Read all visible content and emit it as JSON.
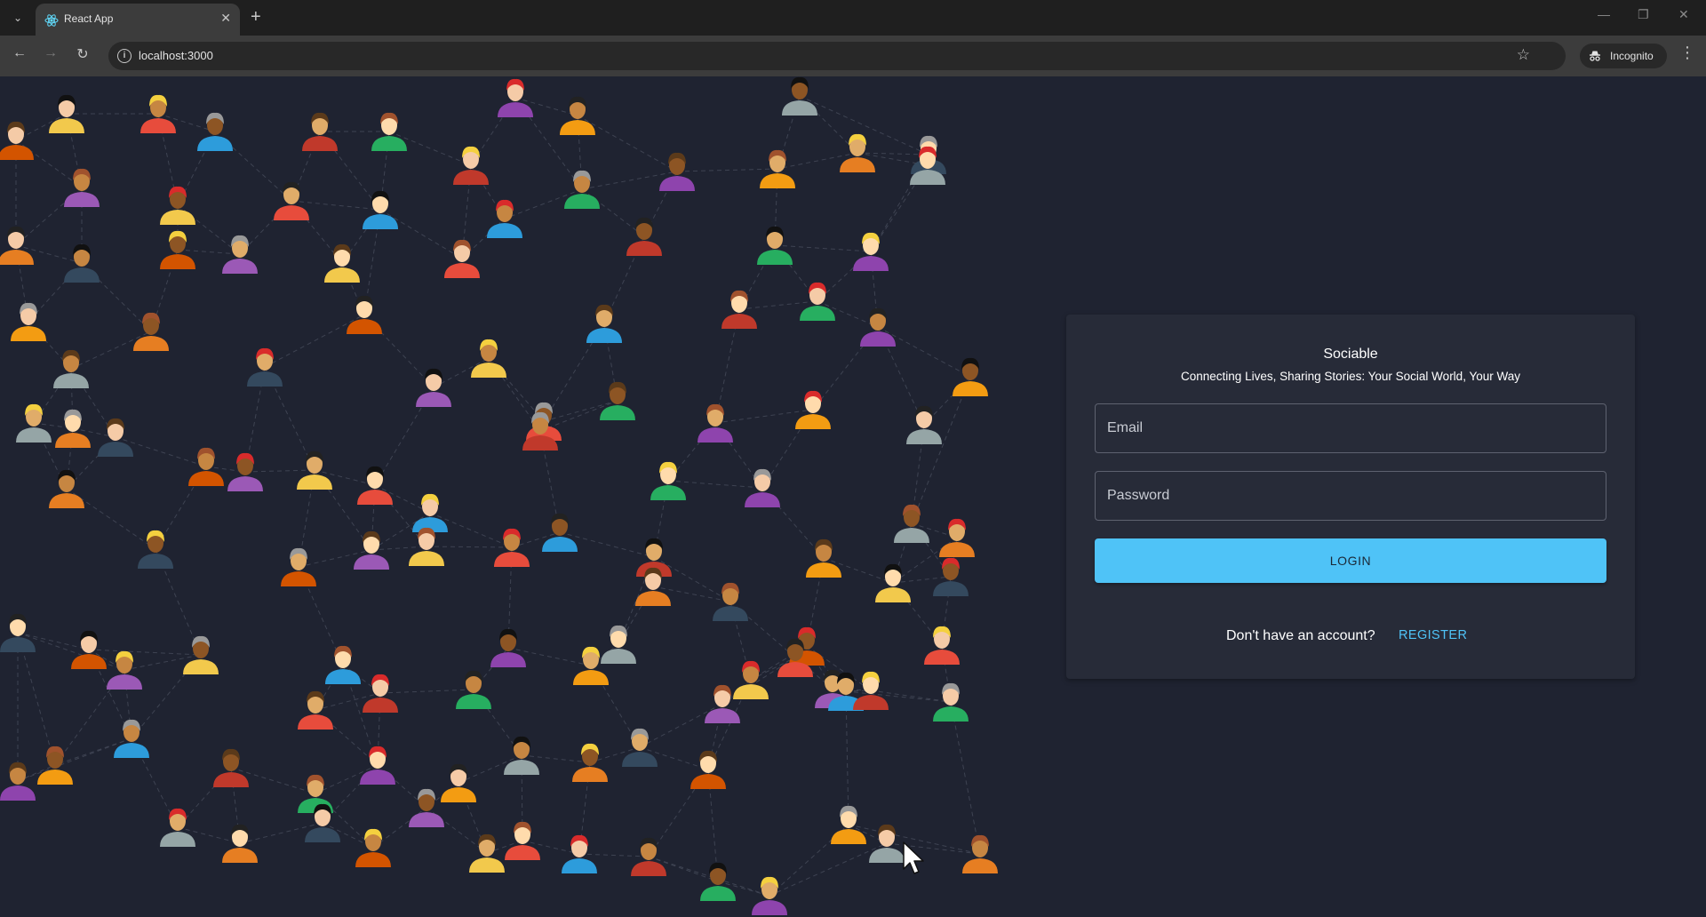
{
  "browser": {
    "tab_title": "React App",
    "url": "localhost:3000",
    "incognito_label": "Incognito"
  },
  "login": {
    "app_name": "Sociable",
    "tagline": "Connecting Lives, Sharing Stories: Your Social World, Your Way",
    "email_placeholder": "Email",
    "password_placeholder": "Password",
    "login_label": "LOGIN",
    "no_account_text": "Don't have an account?",
    "register_label": "REGISTER"
  },
  "colors": {
    "page_background": "#1f2331",
    "card_background": "#272b38",
    "accent": "#4fc3f7"
  },
  "illustration": {
    "subject": "people-network",
    "icon": "avatar-icon"
  }
}
